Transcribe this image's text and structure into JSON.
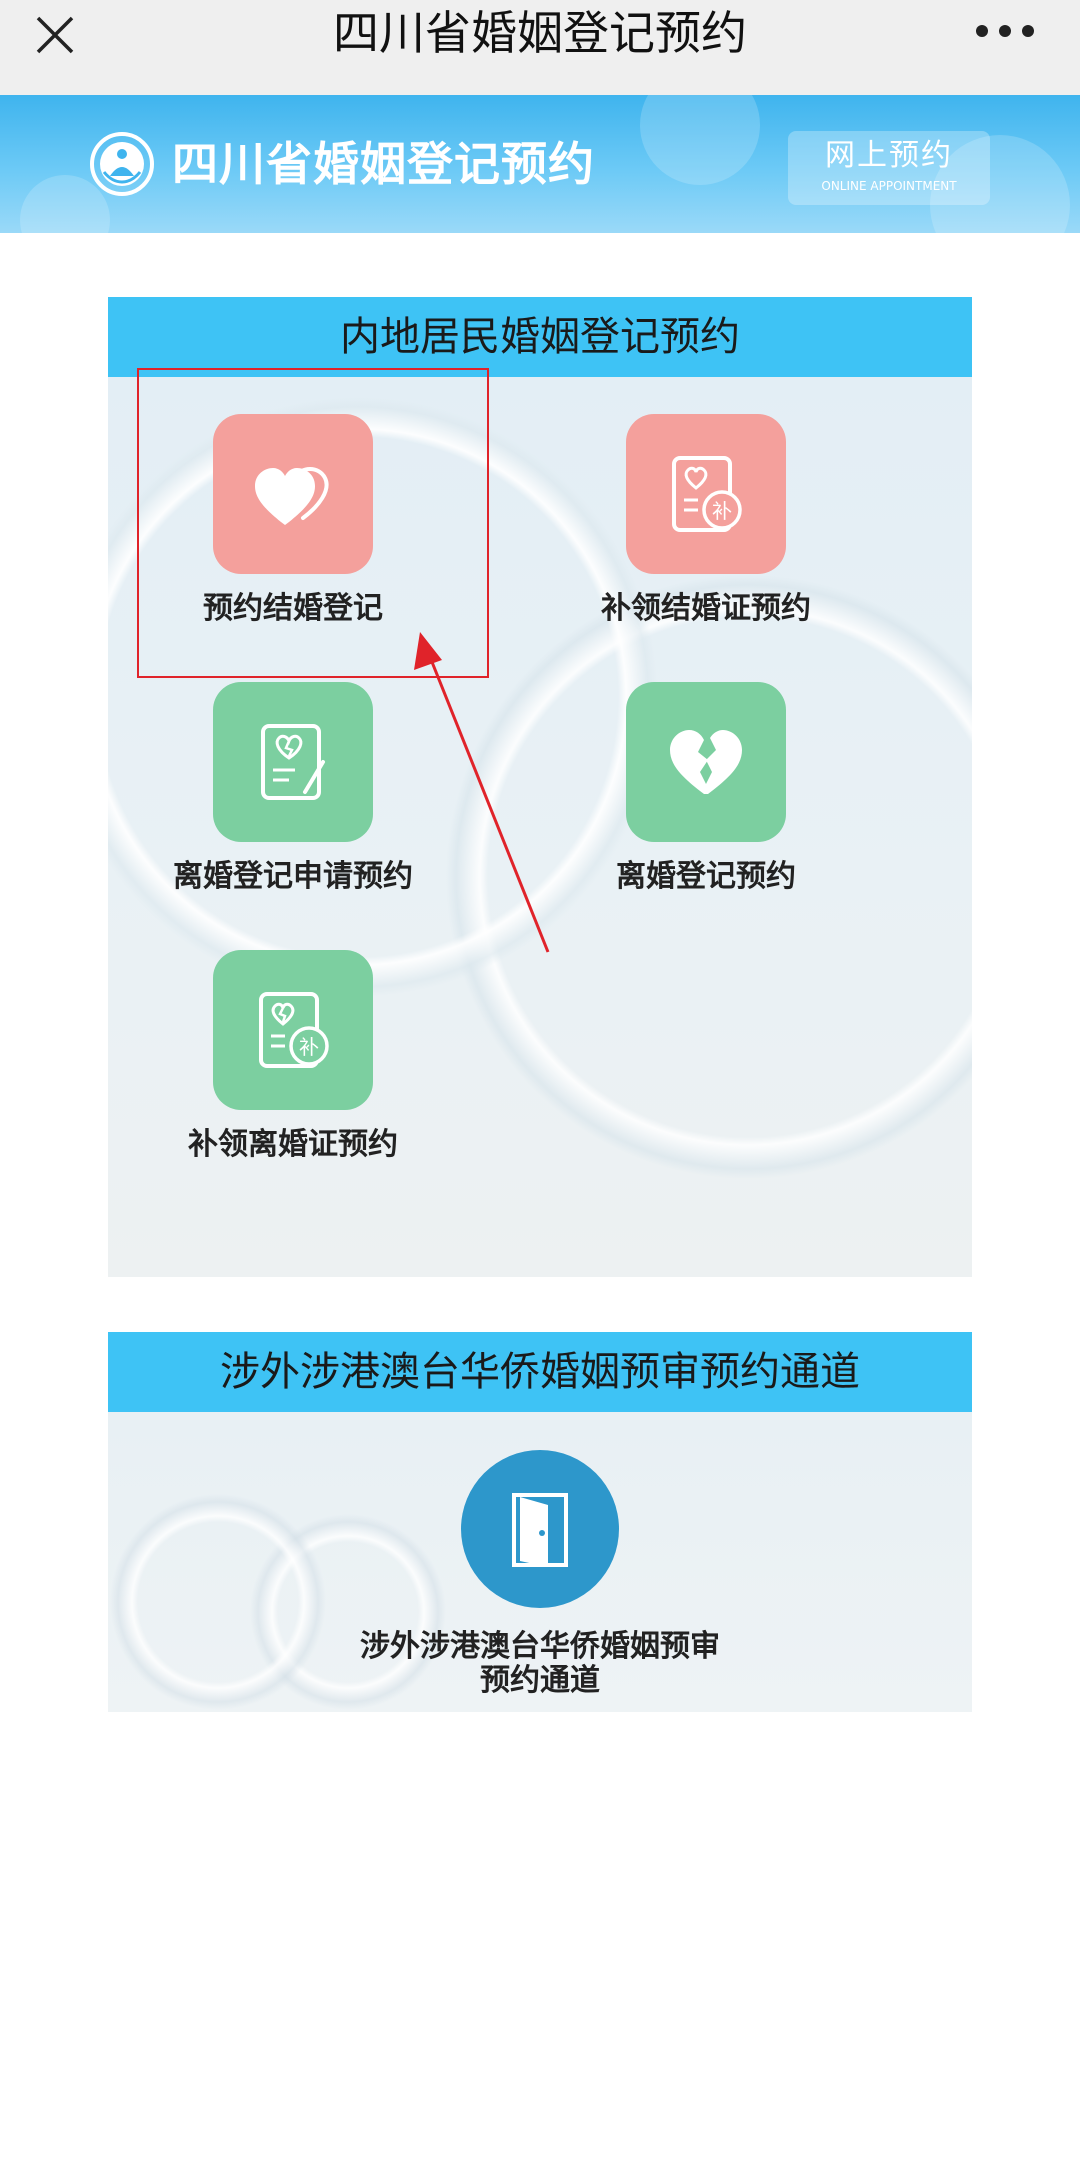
{
  "navbar": {
    "title": "四川省婚姻登记预约",
    "close_icon": "close-icon",
    "more_icon": "more-dots-icon"
  },
  "banner": {
    "title": "四川省婚姻登记预约",
    "badge_cn": "网上预约",
    "badge_en": "ONLINE APPOINTMENT",
    "logo_icon": "civil-affairs-logo-icon"
  },
  "section_mainland": {
    "header": "内地居民婚姻登记预约",
    "tiles": [
      {
        "label": "预约结婚登记",
        "icon": "two-hearts-icon",
        "color": "#f4a09c"
      },
      {
        "label": "补领结婚证预约",
        "icon": "certificate-reissue-icon",
        "color": "#f4a09c"
      },
      {
        "label": "离婚登记申请预约",
        "icon": "divorce-application-icon",
        "color": "#7ccfa0"
      },
      {
        "label": "离婚登记预约",
        "icon": "broken-heart-icon",
        "color": "#7ccfa0"
      },
      {
        "label": "补领离婚证预约",
        "icon": "divorce-certificate-reissue-icon",
        "color": "#7ccfa0"
      }
    ]
  },
  "section_overseas": {
    "header": "涉外涉港澳台华侨婚姻预审预约通道",
    "tile": {
      "label": "涉外涉港澳台华侨婚姻预审预约通道",
      "icon": "door-icon",
      "color": "#2d97cb"
    }
  },
  "annotation": {
    "color": "#e0232a"
  }
}
